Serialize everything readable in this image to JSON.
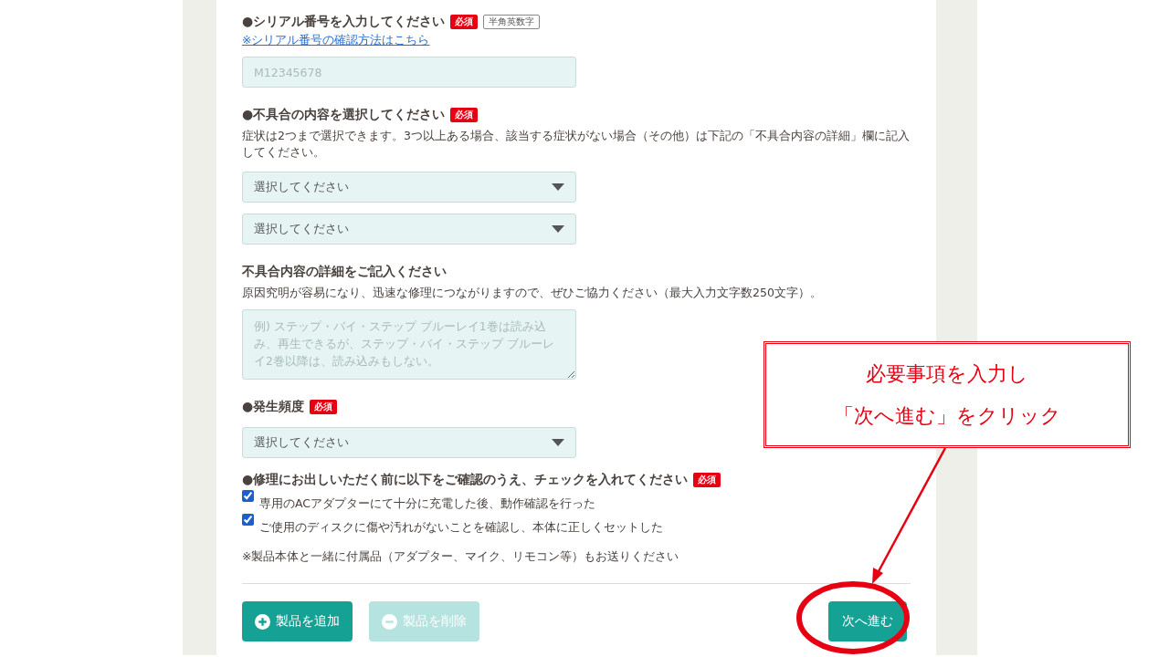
{
  "sections": [
    {
      "kind": "text_input",
      "label": "●シリアル番号を入力してください",
      "required_badge": "必須",
      "format_badge": "半角英数字",
      "help_link": "※シリアル番号の確認方法はこちら",
      "placeholder": "M12345678"
    },
    {
      "kind": "selects",
      "label": "●不具合の内容を選択してください",
      "required_badge": "必須",
      "description": "症状は2つまで選択できます。3つ以上ある場合、該当する症状がない場合（その他）は下記の「不具合内容の詳細」欄に記入してください。",
      "selects": [
        {
          "value": "選択してください"
        },
        {
          "value": "選択してください"
        }
      ]
    },
    {
      "kind": "textarea",
      "label": "不具合内容の詳細をご記入ください",
      "description": "原因究明が容易になり、迅速な修理につながりますので、ぜひご協力ください（最大入力文字数250文字）。",
      "placeholder": "例) ステップ・バイ・ステップ ブルーレイ1巻は読み込み、再生できるが、ステップ・バイ・ステップ ブルーレイ2巻以降は、読み込みもしない。"
    },
    {
      "kind": "selects",
      "label": "●発生頻度",
      "required_badge": "必須",
      "selects": [
        {
          "value": "選択してください"
        }
      ]
    },
    {
      "kind": "checklist",
      "label": "●修理にお出しいただく前に以下をご確認のうえ、チェックを入れてください",
      "required_badge": "必須",
      "items": [
        {
          "label": "専用のACアダプターにて十分に充電した後、動作確認を行った",
          "checked": true
        },
        {
          "label": "ご使用のディスクに傷や汚れがないことを確認し、本体に正しくセットした",
          "checked": true
        }
      ],
      "note": "※製品本体と一緒に付属品（アダプター、マイク、リモコン等）もお送りください"
    }
  ],
  "add_button": {
    "label": "製品を追加",
    "disabled": false
  },
  "remove_button": {
    "label": "製品を削除",
    "disabled": true
  },
  "next_button": {
    "label": "次へ進む"
  },
  "annotation": {
    "lines": [
      "必要事項を入力し",
      "「次へ進む」をクリック"
    ]
  }
}
